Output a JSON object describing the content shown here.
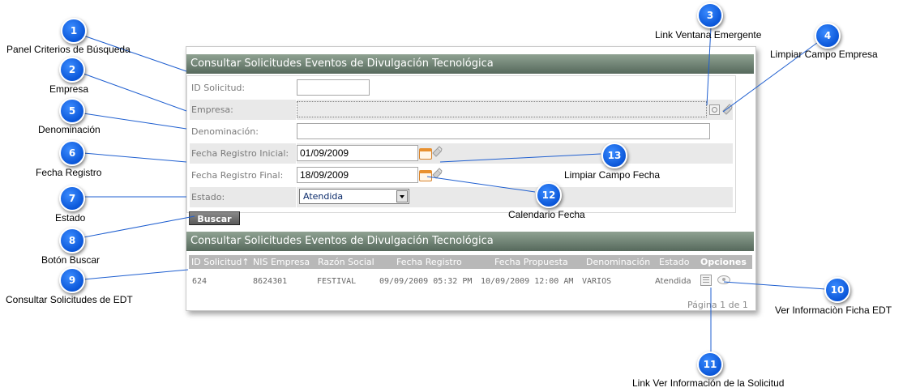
{
  "panel": {
    "search_title": "Consultar Solicitudes Eventos de Divulgación Tecnológica",
    "results_title": "Consultar Solicitudes Eventos de Divulgación Tecnológica"
  },
  "form": {
    "id_label": "ID Solicitud:",
    "id_value": "",
    "empresa_label": "Empresa:",
    "empresa_value": "",
    "denominacion_label": "Denominación:",
    "denominacion_value": "",
    "fecha_inicial_label": "Fecha Registro Inicial:",
    "fecha_inicial_value": "01/09/2009",
    "fecha_final_label": "Fecha Registro Final:",
    "fecha_final_value": "18/09/2009",
    "estado_label": "Estado:",
    "estado_value": "Atendida",
    "buscar_label": "Buscar"
  },
  "table": {
    "columns": [
      "ID Solicitud↑",
      "NIS Empresa",
      "Razón Social",
      "Fecha Registro",
      "Fecha Propuesta",
      "Denominación",
      "Estado",
      "Opciones"
    ],
    "rows": [
      {
        "id": "624",
        "nis": "8624301",
        "razon": "FESTIVAL",
        "fecha_registro": "09/09/2009 05:32 PM",
        "fecha_propuesta": "10/09/2009 12:00 AM",
        "denominacion": "VARIOS",
        "estado": "Atendida"
      }
    ],
    "pager": "Página 1 de 1"
  },
  "icons": {
    "empresa_popup": "magnifier-window-icon",
    "empresa_clear": "eraser-icon",
    "fecha_calendar": "calendar-icon",
    "fecha_clear": "eraser-icon",
    "ver_ficha": "document-list-icon",
    "ver_info": "eye-icon"
  },
  "annotations": [
    {
      "num": "1",
      "text": "Panel Criterios de Búsqueda"
    },
    {
      "num": "2",
      "text": "Empresa"
    },
    {
      "num": "3",
      "text": "Link Ventana Emergente"
    },
    {
      "num": "4",
      "text": "Limpiar Campo Empresa"
    },
    {
      "num": "5",
      "text": "Denominación"
    },
    {
      "num": "6",
      "text": "Fecha Registro"
    },
    {
      "num": "7",
      "text": "Estado"
    },
    {
      "num": "8",
      "text": "Botón Buscar"
    },
    {
      "num": "9",
      "text": "Consultar Solicitudes de EDT"
    },
    {
      "num": "10",
      "text": "Ver Informaciòn Ficha  EDT"
    },
    {
      "num": "11",
      "text": "Link Ver Información de la Solicitud"
    },
    {
      "num": "12",
      "text": "Calendario Fecha"
    },
    {
      "num": "13",
      "text": "Limpiar Campo Fecha"
    }
  ],
  "colors": {
    "badge": "#0a56d8",
    "title_bar": "#56695c",
    "row_shade": "#e9e9e9",
    "table_head": "#b8b8b8"
  }
}
